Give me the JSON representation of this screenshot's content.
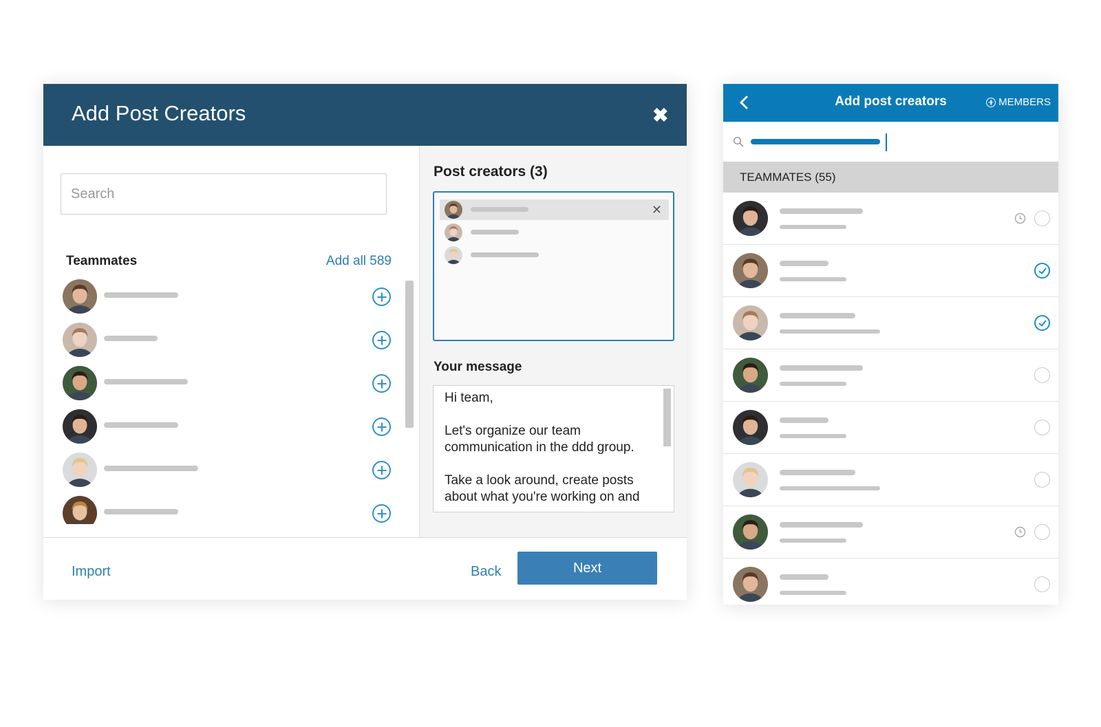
{
  "modal": {
    "title": "Add Post Creators",
    "close_glyph": "✖",
    "search_placeholder": "Search",
    "teammates_label": "Teammates",
    "add_all_label": "Add all 589",
    "teammates": [
      {
        "avatar": {
          "skin": "#e3b89a",
          "hair": "#5b3a28",
          "bg": "#8a7560"
        },
        "name_bar_width": 108
      },
      {
        "avatar": {
          "skin": "#efd2c0",
          "hair": "#a77a57",
          "bg": "#c9b9ad"
        },
        "name_bar_width": 78
      },
      {
        "avatar": {
          "skin": "#d7a988",
          "hair": "#2c1d14",
          "bg": "#3f5a3c"
        },
        "name_bar_width": 122
      },
      {
        "avatar": {
          "skin": "#e0b497",
          "hair": "#2a1c16",
          "bg": "#2f2f33"
        },
        "name_bar_width": 108
      },
      {
        "avatar": {
          "skin": "#f0d4bf",
          "hair": "#e2c48a",
          "bg": "#d9dbdc"
        },
        "name_bar_width": 137
      },
      {
        "avatar": {
          "skin": "#e8c19f",
          "hair": "#b98640",
          "bg": "#5c3e2b"
        },
        "name_bar_width": 108
      }
    ],
    "post_creators_label": "Post creators (3)",
    "post_creators": [
      {
        "avatar": {
          "skin": "#e3b89a",
          "hair": "#5b3a28",
          "bg": "#8a7560"
        },
        "name_bar_width": 84,
        "selected": true,
        "remove_glyph": "✕"
      },
      {
        "avatar": {
          "skin": "#efd2c0",
          "hair": "#a77a57",
          "bg": "#c9b9ad"
        },
        "name_bar_width": 70,
        "selected": false
      },
      {
        "avatar": {
          "skin": "#f0d4bf",
          "hair": "#e2c48a",
          "bg": "#d9dbdc"
        },
        "name_bar_width": 99,
        "selected": false
      }
    ],
    "message_label": "Your message",
    "message_paragraphs": [
      "Hi team,",
      "Let's organize our team communication in the ddd group.",
      "Take a look around, create posts about what you're working on and"
    ],
    "import_label": "Import",
    "back_label": "Back",
    "next_label": "Next"
  },
  "mobile": {
    "title": "Add post creators",
    "members_label": "MEMBERS",
    "section_label": "TEAMMATES (55)",
    "accent_color": "#0b7bb8",
    "rows": [
      {
        "avatar": {
          "skin": "#e0b497",
          "hair": "#2a1c16",
          "bg": "#2f2f33"
        },
        "bar1": 121,
        "bar2": 97,
        "state": "empty",
        "pending": true
      },
      {
        "avatar": {
          "skin": "#e3b89a",
          "hair": "#5b3a28",
          "bg": "#8a7560"
        },
        "bar1": 71,
        "bar2": 97,
        "state": "checked",
        "pending": false
      },
      {
        "avatar": {
          "skin": "#efd2c0",
          "hair": "#a77a57",
          "bg": "#c9b9ad"
        },
        "bar1": 110,
        "bar2": 146,
        "state": "checked",
        "pending": false
      },
      {
        "avatar": {
          "skin": "#d7a988",
          "hair": "#2c1d14",
          "bg": "#3f5a3c"
        },
        "bar1": 121,
        "bar2": 97,
        "state": "empty",
        "pending": false
      },
      {
        "avatar": {
          "skin": "#e0b497",
          "hair": "#2a1c16",
          "bg": "#2f2f33"
        },
        "bar1": 71,
        "bar2": 97,
        "state": "empty",
        "pending": false
      },
      {
        "avatar": {
          "skin": "#f0d4bf",
          "hair": "#e2c48a",
          "bg": "#d9dbdc"
        },
        "bar1": 110,
        "bar2": 146,
        "state": "empty",
        "pending": false
      },
      {
        "avatar": {
          "skin": "#d7a988",
          "hair": "#2c1d14",
          "bg": "#3f5a3c"
        },
        "bar1": 121,
        "bar2": 97,
        "state": "empty",
        "pending": true
      },
      {
        "avatar": {
          "skin": "#e3b89a",
          "hair": "#5b3a28",
          "bg": "#8a7560"
        },
        "bar1": 71,
        "bar2": 97,
        "state": "empty",
        "pending": false
      }
    ]
  }
}
